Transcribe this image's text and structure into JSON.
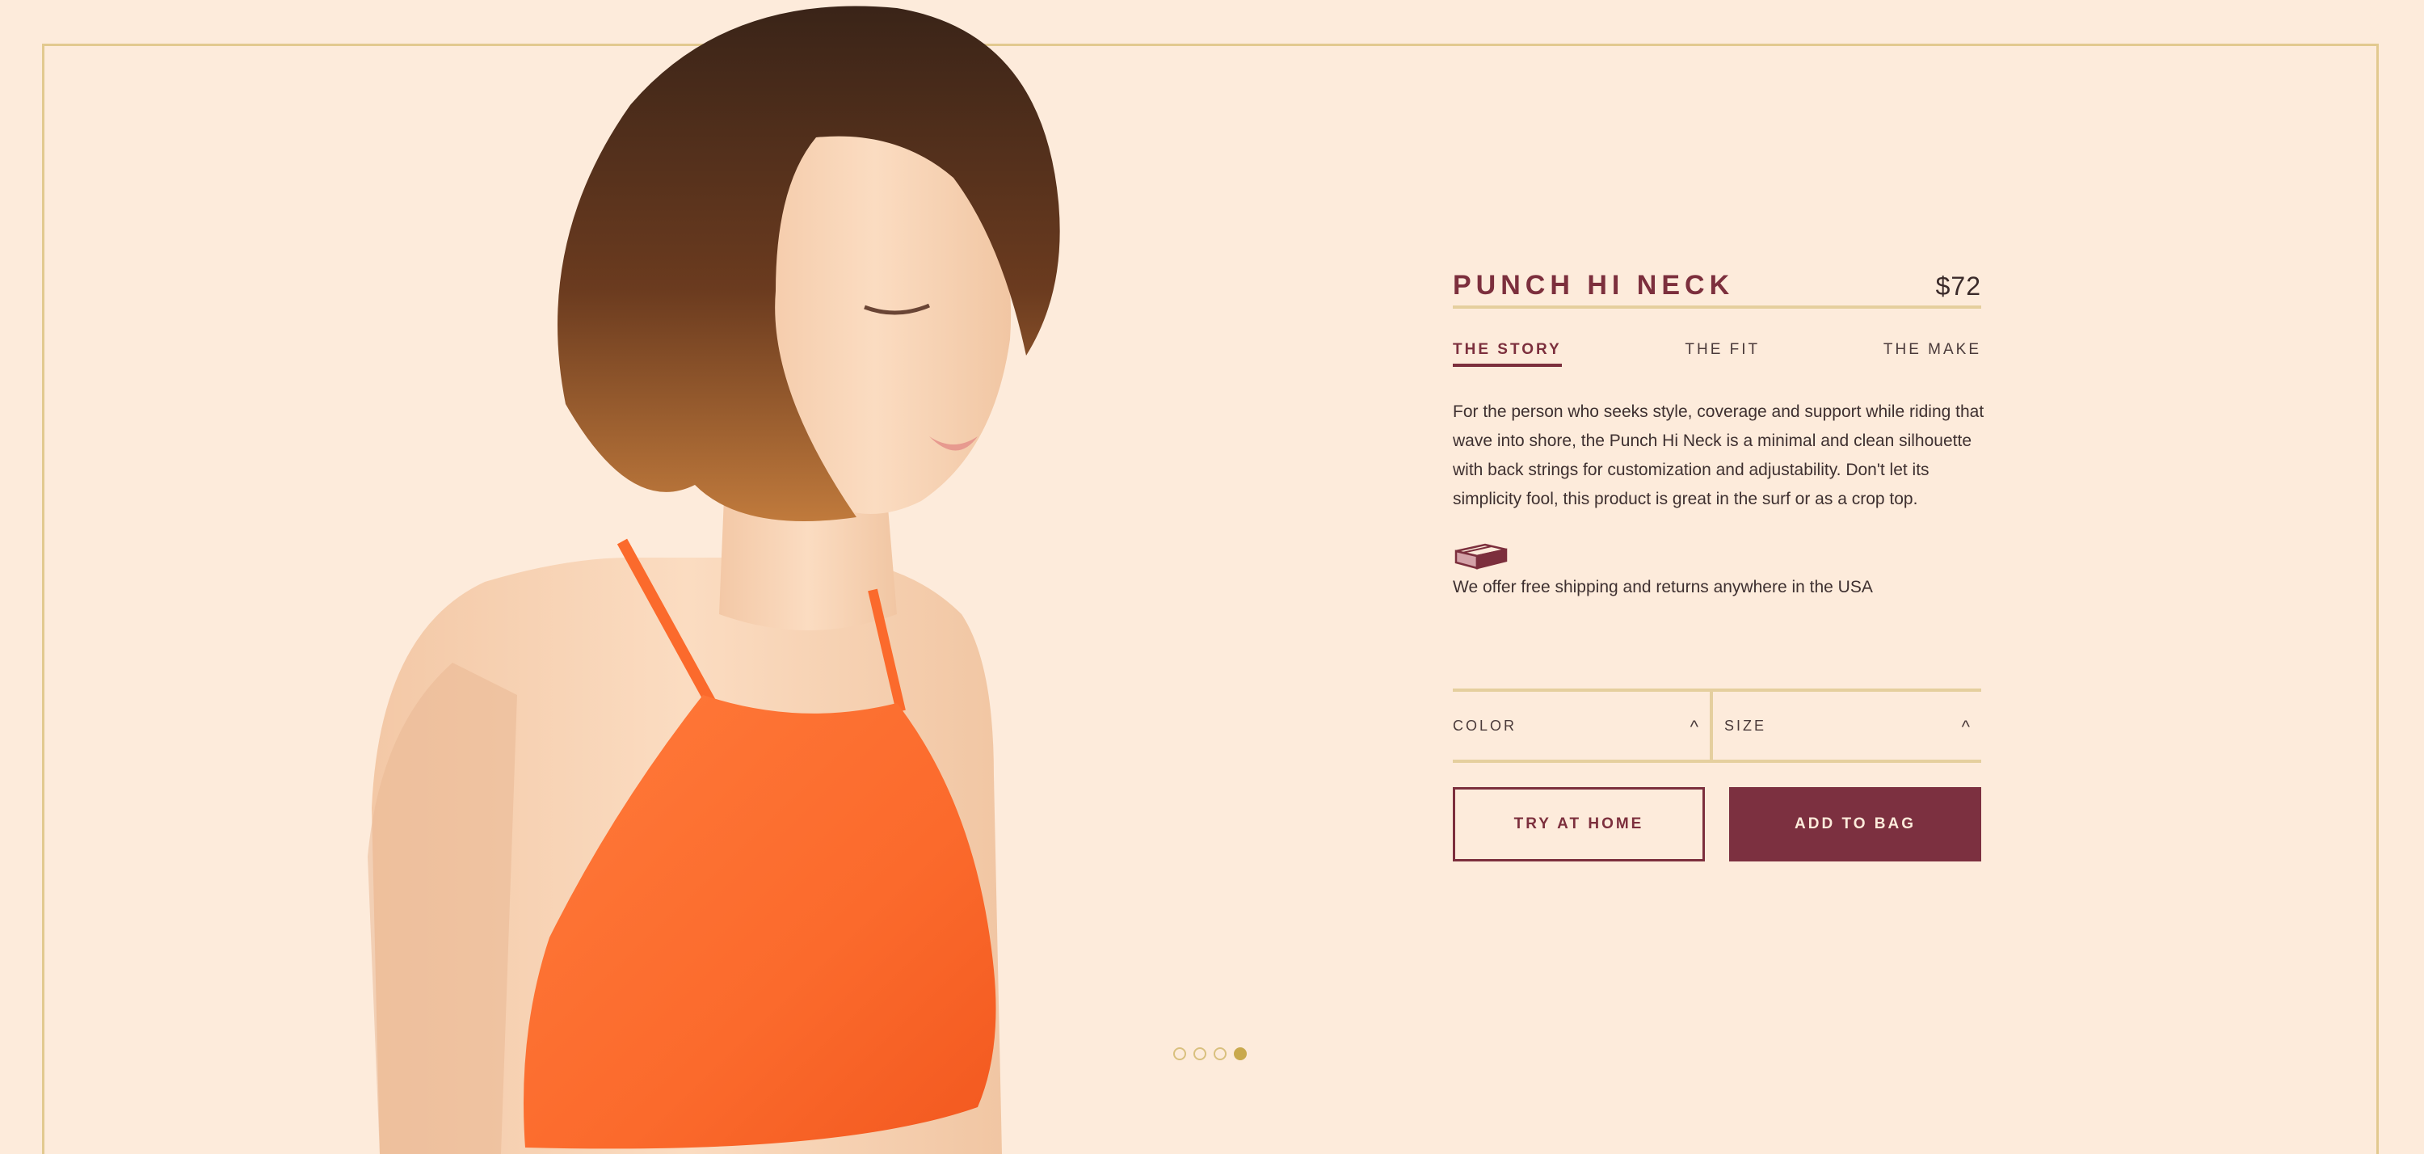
{
  "product": {
    "name": "PUNCH HI NECK",
    "price": "$72"
  },
  "tabs": [
    {
      "label": "THE STORY",
      "active": true
    },
    {
      "label": "THE FIT",
      "active": false
    },
    {
      "label": "THE MAKE",
      "active": false
    }
  ],
  "story_text": "For the person who seeks style, coverage and support while riding that wave into shore, the Punch Hi Neck is a minimal and clean silhouette with back strings for customization and adjustability. Don't let its simplicity fool, this product is great in the surf or as a crop top.",
  "shipping": {
    "icon": "box-icon",
    "text": "We offer free shipping and returns anywhere in the USA"
  },
  "selectors": {
    "color_label": "COLOR",
    "size_label": "SIZE",
    "chevron": "^"
  },
  "buttons": {
    "try_at_home": "TRY AT HOME",
    "add_to_bag": "ADD TO BAG"
  },
  "carousel": {
    "total": 4,
    "active_index": 3
  },
  "colors": {
    "background": "#fdebdb",
    "accent": "#7c2f3d",
    "gold": "#e5cf9e",
    "product_orange": "#fb6a2c"
  }
}
